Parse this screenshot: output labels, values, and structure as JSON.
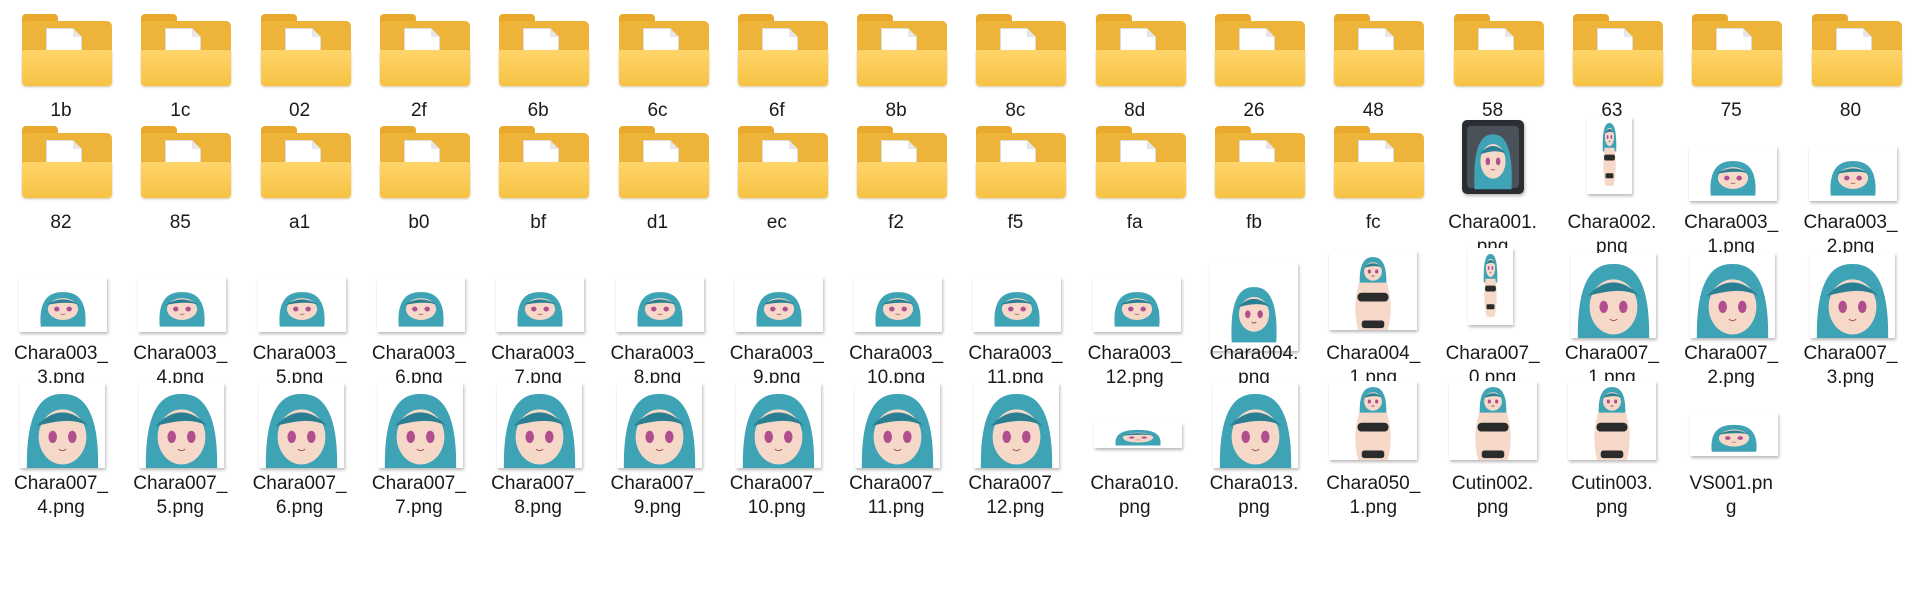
{
  "items": [
    {
      "name": "1b",
      "type": "folder"
    },
    {
      "name": "1c",
      "type": "folder"
    },
    {
      "name": "02",
      "type": "folder"
    },
    {
      "name": "2f",
      "type": "folder"
    },
    {
      "name": "6b",
      "type": "folder"
    },
    {
      "name": "6c",
      "type": "folder"
    },
    {
      "name": "6f",
      "type": "folder"
    },
    {
      "name": "8b",
      "type": "folder"
    },
    {
      "name": "8c",
      "type": "folder"
    },
    {
      "name": "8d",
      "type": "folder"
    },
    {
      "name": "26",
      "type": "folder"
    },
    {
      "name": "48",
      "type": "folder"
    },
    {
      "name": "58",
      "type": "folder"
    },
    {
      "name": "63",
      "type": "folder"
    },
    {
      "name": "75",
      "type": "folder"
    },
    {
      "name": "80",
      "type": "folder"
    },
    {
      "name": "82",
      "type": "folder"
    },
    {
      "name": "85",
      "type": "folder"
    },
    {
      "name": "a1",
      "type": "folder"
    },
    {
      "name": "b0",
      "type": "folder"
    },
    {
      "name": "bf",
      "type": "folder"
    },
    {
      "name": "d1",
      "type": "folder"
    },
    {
      "name": "ec",
      "type": "folder"
    },
    {
      "name": "f2",
      "type": "folder"
    },
    {
      "name": "f5",
      "type": "folder"
    },
    {
      "name": "fa",
      "type": "folder"
    },
    {
      "name": "fb",
      "type": "folder"
    },
    {
      "name": "fc",
      "type": "folder"
    },
    {
      "name": "Chara001.\npng",
      "type": "image",
      "style": "portrait-dark"
    },
    {
      "name": "Chara002.\npng",
      "type": "image",
      "style": "tall"
    },
    {
      "name": "Chara003_\n1.png",
      "type": "image",
      "style": "wide"
    },
    {
      "name": "Chara003_\n2.png",
      "type": "image",
      "style": "wide"
    },
    {
      "name": "Chara003_\n3.png",
      "type": "image",
      "style": "wide"
    },
    {
      "name": "Chara003_\n4.png",
      "type": "image",
      "style": "wide"
    },
    {
      "name": "Chara003_\n5.png",
      "type": "image",
      "style": "wide"
    },
    {
      "name": "Chara003_\n6.png",
      "type": "image",
      "style": "wide"
    },
    {
      "name": "Chara003_\n7.png",
      "type": "image",
      "style": "wide"
    },
    {
      "name": "Chara003_\n8.png",
      "type": "image",
      "style": "wide"
    },
    {
      "name": "Chara003_\n9.png",
      "type": "image",
      "style": "wide"
    },
    {
      "name": "Chara003_\n10.png",
      "type": "image",
      "style": "wide"
    },
    {
      "name": "Chara003_\n11.png",
      "type": "image",
      "style": "wide"
    },
    {
      "name": "Chara003_\n12.png",
      "type": "image",
      "style": "wide"
    },
    {
      "name": "Chara004.\npng",
      "type": "image",
      "style": "small"
    },
    {
      "name": "Chara004_\n1.png",
      "type": "image",
      "style": "full"
    },
    {
      "name": "Chara007_\n0.png",
      "type": "image",
      "style": "tall"
    },
    {
      "name": "Chara007_\n1.png",
      "type": "image",
      "style": "face"
    },
    {
      "name": "Chara007_\n2.png",
      "type": "image",
      "style": "face"
    },
    {
      "name": "Chara007_\n3.png",
      "type": "image",
      "style": "face"
    },
    {
      "name": "Chara007_\n4.png",
      "type": "image",
      "style": "face"
    },
    {
      "name": "Chara007_\n5.png",
      "type": "image",
      "style": "face"
    },
    {
      "name": "Chara007_\n6.png",
      "type": "image",
      "style": "face"
    },
    {
      "name": "Chara007_\n7.png",
      "type": "image",
      "style": "face"
    },
    {
      "name": "Chara007_\n8.png",
      "type": "image",
      "style": "face"
    },
    {
      "name": "Chara007_\n9.png",
      "type": "image",
      "style": "face"
    },
    {
      "name": "Chara007_\n10.png",
      "type": "image",
      "style": "face"
    },
    {
      "name": "Chara007_\n11.png",
      "type": "image",
      "style": "face"
    },
    {
      "name": "Chara007_\n12.png",
      "type": "image",
      "style": "face"
    },
    {
      "name": "Chara010.\npng",
      "type": "image",
      "style": "strip"
    },
    {
      "name": "Chara013.\npng",
      "type": "image",
      "style": "face"
    },
    {
      "name": "Chara050_\n1.png",
      "type": "image",
      "style": "full"
    },
    {
      "name": "Cutin002.\npng",
      "type": "image",
      "style": "full"
    },
    {
      "name": "Cutin003.\npng",
      "type": "image",
      "style": "full"
    },
    {
      "name": "VS001.pn\ng",
      "type": "image",
      "style": "banner"
    }
  ],
  "colors": {
    "hair": "#3ea3b5",
    "hair_dark": "#2a7f93",
    "skin": "#f6d8c8",
    "eye": "#b04e8f",
    "bikini": "#2b2b2b"
  }
}
